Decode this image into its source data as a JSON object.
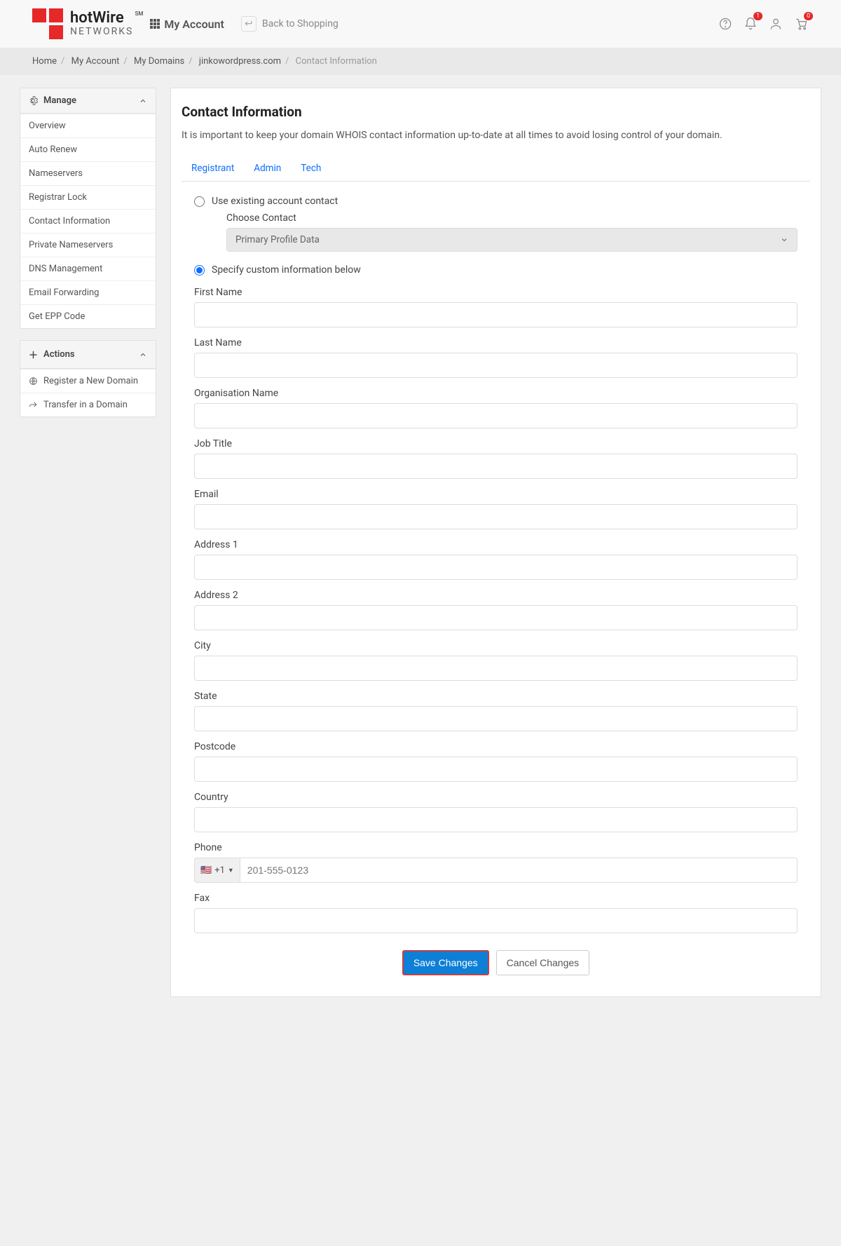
{
  "brand": {
    "name": "hotWire",
    "tagline": "NETWORKS",
    "sm": "SM"
  },
  "header": {
    "my_account": "My Account",
    "back_to_shopping": "Back to Shopping",
    "notif_badge": "1",
    "cart_badge": "0"
  },
  "breadcrumb": {
    "items": [
      "Home",
      "My Account",
      "My Domains",
      "jinkowordpress.com"
    ],
    "current": "Contact Information"
  },
  "sidebar": {
    "manage_label": "Manage",
    "manage_items": [
      "Overview",
      "Auto Renew",
      "Nameservers",
      "Registrar Lock",
      "Contact Information",
      "Private Nameservers",
      "DNS Management",
      "Email Forwarding",
      "Get EPP Code"
    ],
    "actions_label": "Actions",
    "actions_items": [
      "Register a New Domain",
      "Transfer in a Domain"
    ]
  },
  "main": {
    "title": "Contact Information",
    "desc": "It is important to keep your domain WHOIS contact information up-to-date at all times to avoid losing control of your domain.",
    "tabs": [
      "Registrant",
      "Admin",
      "Tech"
    ],
    "radio_existing": "Use existing account contact",
    "choose_contact_label": "Choose Contact",
    "choose_contact_value": "Primary Profile Data",
    "radio_custom": "Specify custom information below",
    "fields": {
      "first_name": "First Name",
      "last_name": "Last Name",
      "org": "Organisation Name",
      "job": "Job Title",
      "email": "Email",
      "addr1": "Address 1",
      "addr2": "Address 2",
      "city": "City",
      "state": "State",
      "postcode": "Postcode",
      "country": "Country",
      "phone": "Phone",
      "fax": "Fax"
    },
    "phone": {
      "prefix": "+1",
      "placeholder": "201-555-0123"
    },
    "save_btn": "Save Changes",
    "cancel_btn": "Cancel Changes"
  }
}
